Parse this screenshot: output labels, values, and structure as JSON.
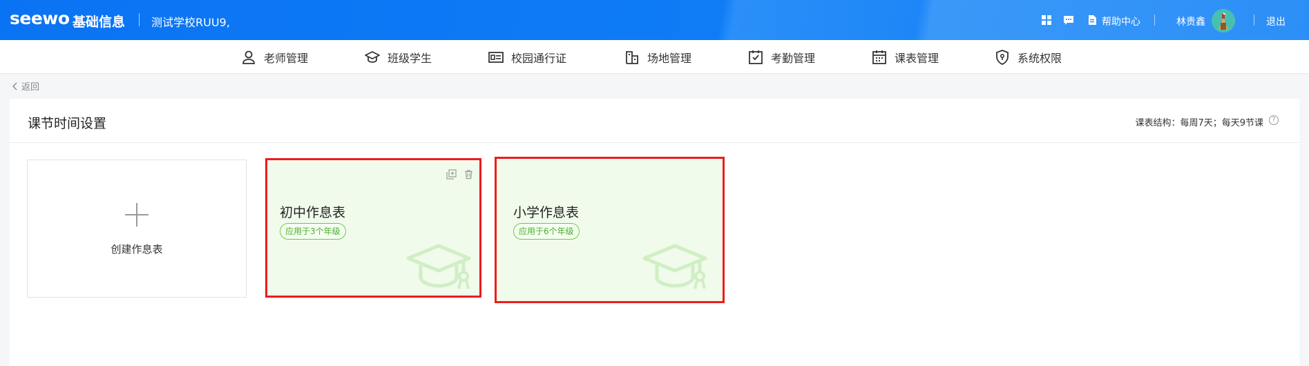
{
  "header": {
    "logo": "seewo",
    "app_title": "基础信息",
    "school": "测试学校RUU9,",
    "help": "帮助中心",
    "username": "林贵鑫",
    "logout": "退出"
  },
  "nav": {
    "items": [
      {
        "label": "老师管理",
        "icon": "person-icon"
      },
      {
        "label": "班级学生",
        "icon": "graduation-cap-icon"
      },
      {
        "label": "校园通行证",
        "icon": "id-card-icon"
      },
      {
        "label": "场地管理",
        "icon": "building-icon"
      },
      {
        "label": "考勤管理",
        "icon": "calendar-check-icon"
      },
      {
        "label": "课表管理",
        "icon": "calendar-icon"
      },
      {
        "label": "系统权限",
        "icon": "shield-icon"
      }
    ]
  },
  "back": "返回",
  "panel": {
    "title": "课节时间设置",
    "structure": "课表结构：每周7天；每天9节课",
    "help_symbol": "?",
    "create_label": "创建作息表",
    "cards": [
      {
        "title": "初中作息表",
        "badge": "应用于3个年级"
      },
      {
        "title": "小学作息表",
        "badge": "应用于6个年级"
      }
    ]
  },
  "colors": {
    "header_blue": "#0a73f3",
    "card_bg": "#f0fbec",
    "badge_green": "#4caf2a",
    "highlight_red": "#ee1b1b"
  }
}
